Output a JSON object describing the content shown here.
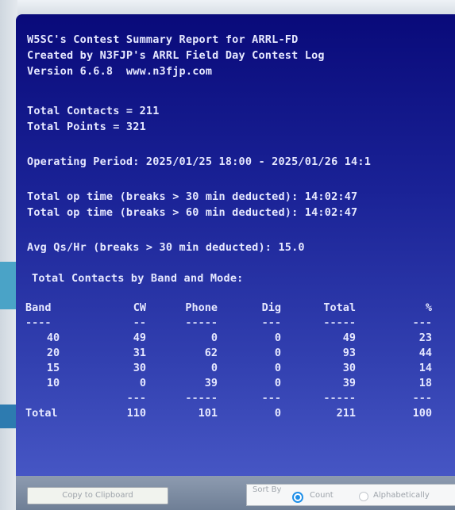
{
  "report": {
    "lines": [
      "W5SC's Contest Summary Report for ARRL-FD",
      "Created by N3FJP's ARRL Field Day Contest Log",
      "Version 6.6.8  www.n3fjp.com"
    ],
    "total_contacts": "Total Contacts = 211",
    "total_points": "Total Points = 321",
    "operating_period": "Operating Period: 2025/01/25 18:00 - 2025/01/26 14:1",
    "op_time_30": "Total op time (breaks > 30 min deducted): 14:02:47",
    "op_time_60": "Total op time (breaks > 60 min deducted): 14:02:47",
    "avg_qs": "Avg Qs/Hr (breaks > 30 min deducted): 15.0",
    "section_title": "Total Contacts by Band and Mode:"
  },
  "table": {
    "headers": {
      "band": "Band",
      "cw": "CW",
      "phone": "Phone",
      "dig": "Dig",
      "total": "Total",
      "pct": "%"
    },
    "dashes": {
      "band": "----",
      "cw": "--",
      "phone": "-----",
      "dig": "---",
      "total": "-----",
      "pct": "---"
    },
    "rows": [
      {
        "band": "40",
        "cw": "49",
        "phone": "0",
        "dig": "0",
        "total": "49",
        "pct": "23"
      },
      {
        "band": "20",
        "cw": "31",
        "phone": "62",
        "dig": "0",
        "total": "93",
        "pct": "44"
      },
      {
        "band": "15",
        "cw": "30",
        "phone": "0",
        "dig": "0",
        "total": "30",
        "pct": "14"
      },
      {
        "band": "10",
        "cw": "0",
        "phone": "39",
        "dig": "0",
        "total": "39",
        "pct": "18"
      }
    ],
    "dashes_bottom": {
      "band": "",
      "cw": "---",
      "phone": "-----",
      "dig": "---",
      "total": "-----",
      "pct": "---"
    },
    "totals": {
      "band": "Total",
      "cw": "110",
      "phone": "101",
      "dig": "0",
      "total": "211",
      "pct": "100"
    }
  },
  "controls": {
    "copy_button": "Copy to Clipboard",
    "sort_by_label": "Sort By",
    "sort_options": [
      {
        "label": "Count",
        "selected": true
      },
      {
        "label": "Alphabetically",
        "selected": false
      }
    ]
  },
  "colors": {
    "screen_top": "#090a7a",
    "screen_bottom": "#4656c4",
    "text": "#e6e8ff",
    "radio_accent": "#1f8fe8"
  }
}
